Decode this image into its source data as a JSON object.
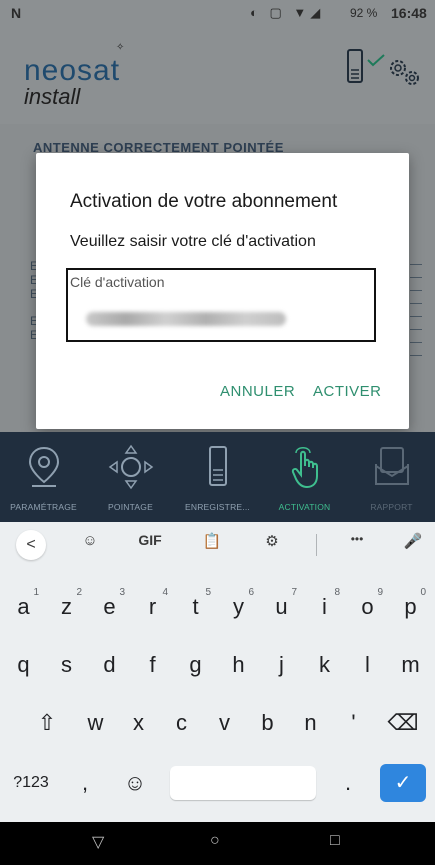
{
  "status_bar": {
    "left_icon": "N",
    "battery": "92 %",
    "time": "16:48"
  },
  "header": {
    "logo_line1": "neosat",
    "logo_line2": "install",
    "logo_sparkle": "✧",
    "icons": [
      "device-check-icon",
      "settings-gears-icon"
    ]
  },
  "background": {
    "title": "ANTENNE CORRECTEMENT POINTÉE"
  },
  "dialog": {
    "title": "Activation de votre abonnement",
    "message": "Veuillez saisir votre clé d'activation",
    "field_label": "Clé d'activation",
    "field_value_blurred": true,
    "cancel_label": "ANNULER",
    "activate_label": "ACTIVER"
  },
  "nav": {
    "items": [
      {
        "label": "PARAMÉTRAGE",
        "icon": "location-pin-icon",
        "state": "normal"
      },
      {
        "label": "POINTAGE",
        "icon": "pointing-arrows-icon",
        "state": "normal"
      },
      {
        "label": "ENREGISTRE...",
        "icon": "device-icon",
        "state": "normal"
      },
      {
        "label": "ACTIVATION",
        "icon": "touch-hand-icon",
        "state": "active"
      },
      {
        "label": "RAPPORT",
        "icon": "report-envelope-icon",
        "state": "disabled"
      }
    ]
  },
  "keyboard": {
    "toolbar": {
      "back": "<",
      "sticker": "☺",
      "gif": "GIF",
      "clipboard": "📋",
      "settings": "⚙",
      "more": "•••",
      "mic": "🎤"
    },
    "row1": [
      {
        "key": "a",
        "hint": "1"
      },
      {
        "key": "z",
        "hint": "2"
      },
      {
        "key": "e",
        "hint": "3"
      },
      {
        "key": "r",
        "hint": "4"
      },
      {
        "key": "t",
        "hint": "5"
      },
      {
        "key": "y",
        "hint": "6"
      },
      {
        "key": "u",
        "hint": "7"
      },
      {
        "key": "i",
        "hint": "8"
      },
      {
        "key": "o",
        "hint": "9"
      },
      {
        "key": "p",
        "hint": "0"
      }
    ],
    "row2": [
      "q",
      "s",
      "d",
      "f",
      "g",
      "h",
      "j",
      "k",
      "l",
      "m"
    ],
    "row3": [
      "w",
      "x",
      "c",
      "v",
      "b",
      "n",
      "'"
    ],
    "shift": "⇧",
    "backspace": "⌫",
    "symbols": "?123",
    "comma": ",",
    "emoji": "☺",
    "period": ".",
    "enter": "✓"
  },
  "system_nav": {
    "back": "▽",
    "home": "○",
    "recents": "□"
  },
  "colors": {
    "accent_green": "#2f8f6f",
    "nav_bg": "#202e3e",
    "enter_blue": "#2f86de"
  }
}
